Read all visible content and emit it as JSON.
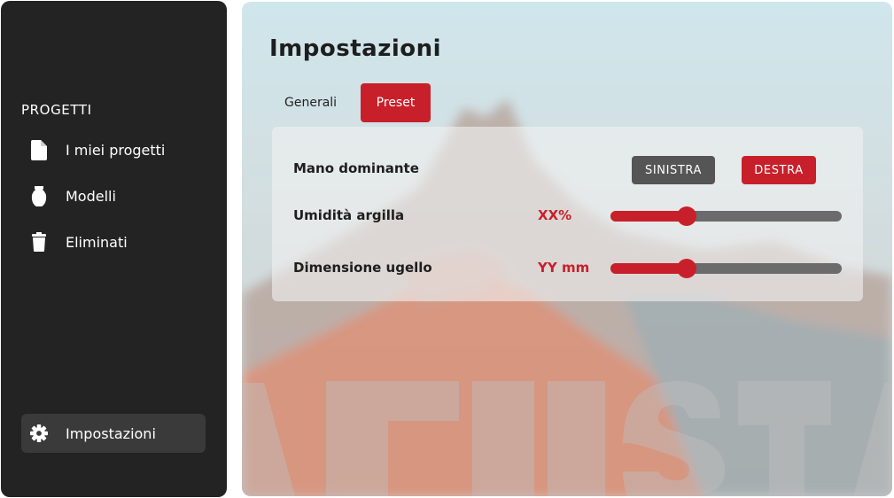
{
  "sidebar": {
    "section_title": "PROGETTI",
    "items": [
      {
        "label": "I miei progetti",
        "icon": "document-icon"
      },
      {
        "label": "Modelli",
        "icon": "vase-icon"
      },
      {
        "label": "Eliminati",
        "icon": "trash-icon"
      }
    ],
    "settings": {
      "label": "Impostazioni",
      "icon": "gear-icon",
      "active": true
    }
  },
  "main": {
    "title": "Impostazioni",
    "tabs": [
      {
        "label": "Generali",
        "active": false
      },
      {
        "label": "Preset",
        "active": true
      }
    ],
    "settings": {
      "hand": {
        "label": "Mano dominante",
        "options": [
          "SINISTRA",
          "DESTRA"
        ],
        "selected": "DESTRA"
      },
      "humidity": {
        "label": "Umidità argilla",
        "value_text": "XX%",
        "level": 0.33
      },
      "nozzle": {
        "label": "Dimensione ugello",
        "value_text": "YY mm",
        "level": 0.33
      }
    }
  },
  "colors": {
    "accent": "#c8202a",
    "sidebar_bg": "#232323",
    "button_inactive": "#555555",
    "slider_track": "#6b6b6b"
  }
}
